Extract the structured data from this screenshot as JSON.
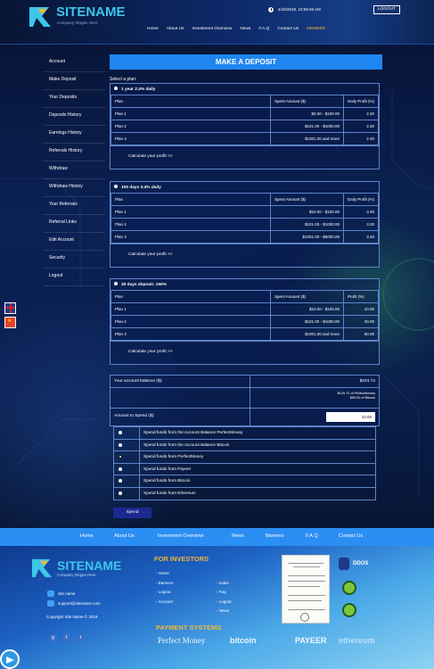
{
  "header": {
    "logo_text": "SITENAME",
    "logo_tagline": "Company Slogan Here",
    "datetime": "4/16/2019, 10:59:46 AM",
    "logout_label": "LOGOUT",
    "nav": [
      "Home",
      "About Us",
      "Investment Overview",
      "News",
      "F.A.Q",
      "Contact Us",
      "MEMBER"
    ]
  },
  "sidebar": {
    "items": [
      "Account",
      "Make Deposit",
      "Your Deposits",
      "Deposits History",
      "Earnings History",
      "Referrals History",
      "Withdraw",
      "Withdraw History",
      "Your Referrals",
      "Referral Links",
      "Edit Account",
      "Security",
      "Logout"
    ]
  },
  "main": {
    "title": "MAKE A DEPOSIT",
    "select_plan": "Select a plan:",
    "plans": [
      {
        "name": "1 year 2.4% daily",
        "cols": [
          "Plan",
          "Spent Amount ($)",
          "Daily Profit (%)"
        ],
        "rows": [
          [
            "Plan 1",
            "$0.00 - $100.00",
            "2.20"
          ],
          [
            "Plan 2",
            "$101.00 - $1000.00",
            "2.30"
          ],
          [
            "Plan 3",
            "$1001.00 and more",
            "2.40"
          ]
        ],
        "calc": "Calculate your profit >>"
      },
      {
        "name": "100 days 3.4% daily",
        "cols": [
          "Plan",
          "Spent Amount ($)",
          "Daily Profit (%)"
        ],
        "rows": [
          [
            "Plan 1",
            "$10.00 - $100.00",
            "3.20"
          ],
          [
            "Plan 2",
            "$101.00 - $1000.00",
            "3.30"
          ],
          [
            "Plan 3",
            "$1001.00 - $5000.00",
            "3.40"
          ]
        ],
        "calc": "Calculate your profit >>"
      },
      {
        "name": "30 days deposit. 150%",
        "cols": [
          "Plan",
          "Spent Amount ($)",
          "Profit (%)"
        ],
        "rows": [
          [
            "Plan 1",
            "$10.00 - $100.00",
            "10.00"
          ],
          [
            "Plan 2",
            "$101.00 - $1000.00",
            "20.00"
          ],
          [
            "Plan 3",
            "$1001.00 and more",
            "50.00"
          ]
        ],
        "calc": "Calculate your profit >>"
      }
    ],
    "balance_label": "Your account balance ($):",
    "balance_value": "$224.72",
    "balance_detail_1": "$129.72 of PerfectMoney",
    "balance_detail_2": "$90.00 of Bitcoin",
    "amount_label": "Amount to Spend ($):",
    "amount_value": "10.00",
    "spend_options": [
      "Spend funds from the Account Balance PerfectMoney",
      "Spend funds from the Account Balance Bitcoin",
      "Spend funds from PerfectMoney",
      "Spend funds from Payeer",
      "Spend funds from Bitcoin",
      "Spend funds from Ethereum"
    ],
    "spend_button": "Spend"
  },
  "footer": {
    "nav": [
      "Home",
      "About Us",
      "Investment Overview",
      "News",
      "Banners",
      "F.A.Q",
      "Contact Us"
    ],
    "logo_text": "SITENAME",
    "logo_tagline": "Company Slogan Here",
    "site_name": "site name",
    "email": "support@sitename.com",
    "copyright": "Copyright Site Name © 2019",
    "for_investors": "FOR INVESTORS",
    "links_col1": [
      "Home",
      "Banners",
      "Logout",
      "Account"
    ],
    "links_col2": [
      "Index",
      "Faq",
      "Logout",
      "News"
    ],
    "payment_title": "PAYMENT SYSTEMS",
    "payment_logos": [
      "Perfect Money",
      "bitcoin",
      "PAYEER",
      "ethereum"
    ],
    "ddos_label": "DDOS"
  },
  "colors": {
    "accent": "#1f86f0",
    "gold": "#f0b63a",
    "logo": "#3ec6ea",
    "border": "#5e85c9"
  }
}
